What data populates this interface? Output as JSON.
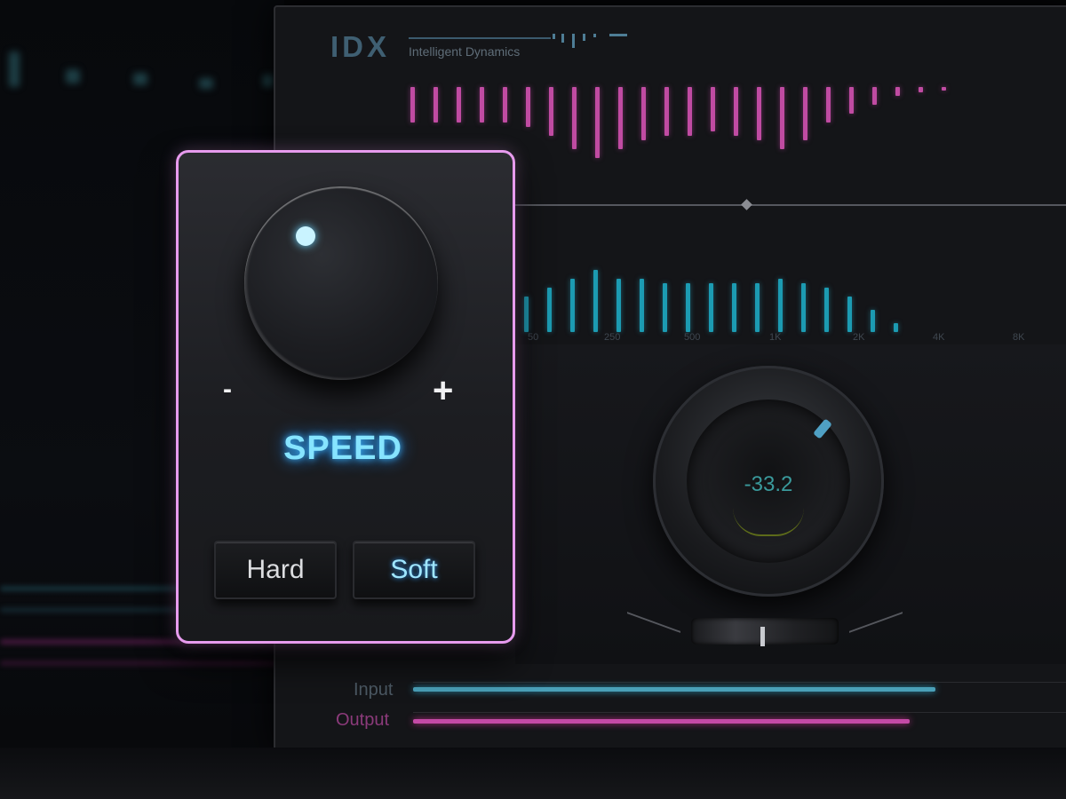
{
  "plugin": {
    "brand": "IDX",
    "brand_subtitle": "Intelligent Dynamics",
    "gain_readout": "-33.2",
    "frequency_labels": [
      "50",
      "250",
      "500",
      "1K",
      "2K",
      "4K",
      "8K"
    ],
    "meters": {
      "input_label": "Input",
      "output_label": "Output",
      "input_level": 0.8,
      "output_level": 0.76
    }
  },
  "speed_panel": {
    "label": "SPEED",
    "minus": "-",
    "plus": "+",
    "buttons": {
      "hard": "Hard",
      "soft": "Soft"
    },
    "selected_mode": "Soft"
  },
  "colors": {
    "accent_cyan": "#86e4ff",
    "panel_border": "#e79bee",
    "pink_bars": "#c04ba2",
    "cyan_bars": "#1c9bb2"
  },
  "icons": {
    "knob_indicator": "dot-indicator-icon"
  }
}
